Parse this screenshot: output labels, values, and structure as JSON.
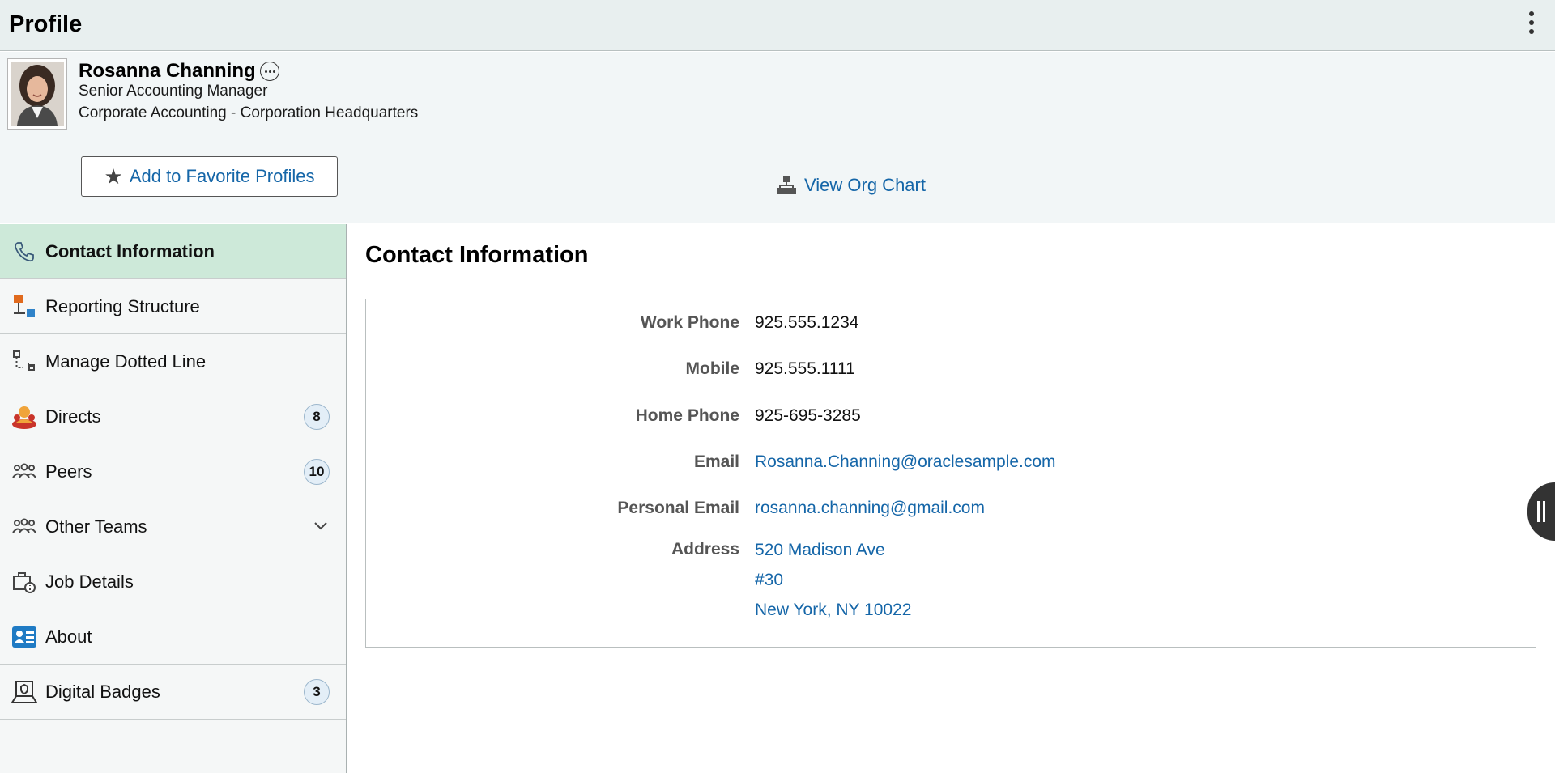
{
  "header": {
    "title": "Profile"
  },
  "profile": {
    "name": "Rosanna Channing",
    "job_title": "Senior Accounting Manager",
    "department": "Corporate Accounting - Corporation Headquarters",
    "favorite_button": "Add to Favorite Profiles",
    "org_chart_link": "View Org Chart"
  },
  "sidebar": {
    "items": [
      {
        "label": "Contact Information",
        "icon": "phone-icon",
        "active": true
      },
      {
        "label": "Reporting Structure",
        "icon": "reporting-structure-icon"
      },
      {
        "label": "Manage Dotted Line",
        "icon": "dotted-line-icon"
      },
      {
        "label": "Directs",
        "icon": "directs-icon",
        "badge": "8"
      },
      {
        "label": "Peers",
        "icon": "peers-icon",
        "badge": "10"
      },
      {
        "label": "Other Teams",
        "icon": "teams-icon",
        "expandable": true
      },
      {
        "label": "Job Details",
        "icon": "job-details-icon"
      },
      {
        "label": "About",
        "icon": "about-icon"
      },
      {
        "label": "Digital Badges",
        "icon": "badge-icon",
        "badge": "3"
      }
    ]
  },
  "contact": {
    "title": "Contact Information",
    "work_phone_label": "Work Phone",
    "work_phone": "925.555.1234",
    "mobile_label": "Mobile",
    "mobile": "925.555.1111",
    "home_phone_label": "Home Phone",
    "home_phone": "925-695-3285",
    "email_label": "Email",
    "email": "Rosanna.Channing@oraclesample.com",
    "personal_email_label": "Personal Email",
    "personal_email": "rosanna.channing@gmail.com",
    "address_label": "Address",
    "address_line1": "520 Madison Ave",
    "address_line2": "#30",
    "address_line3": "New York, NY 10022"
  },
  "colors": {
    "link": "#1566a8",
    "active_nav": "#cde9d9",
    "header_bg": "#e8efef"
  }
}
